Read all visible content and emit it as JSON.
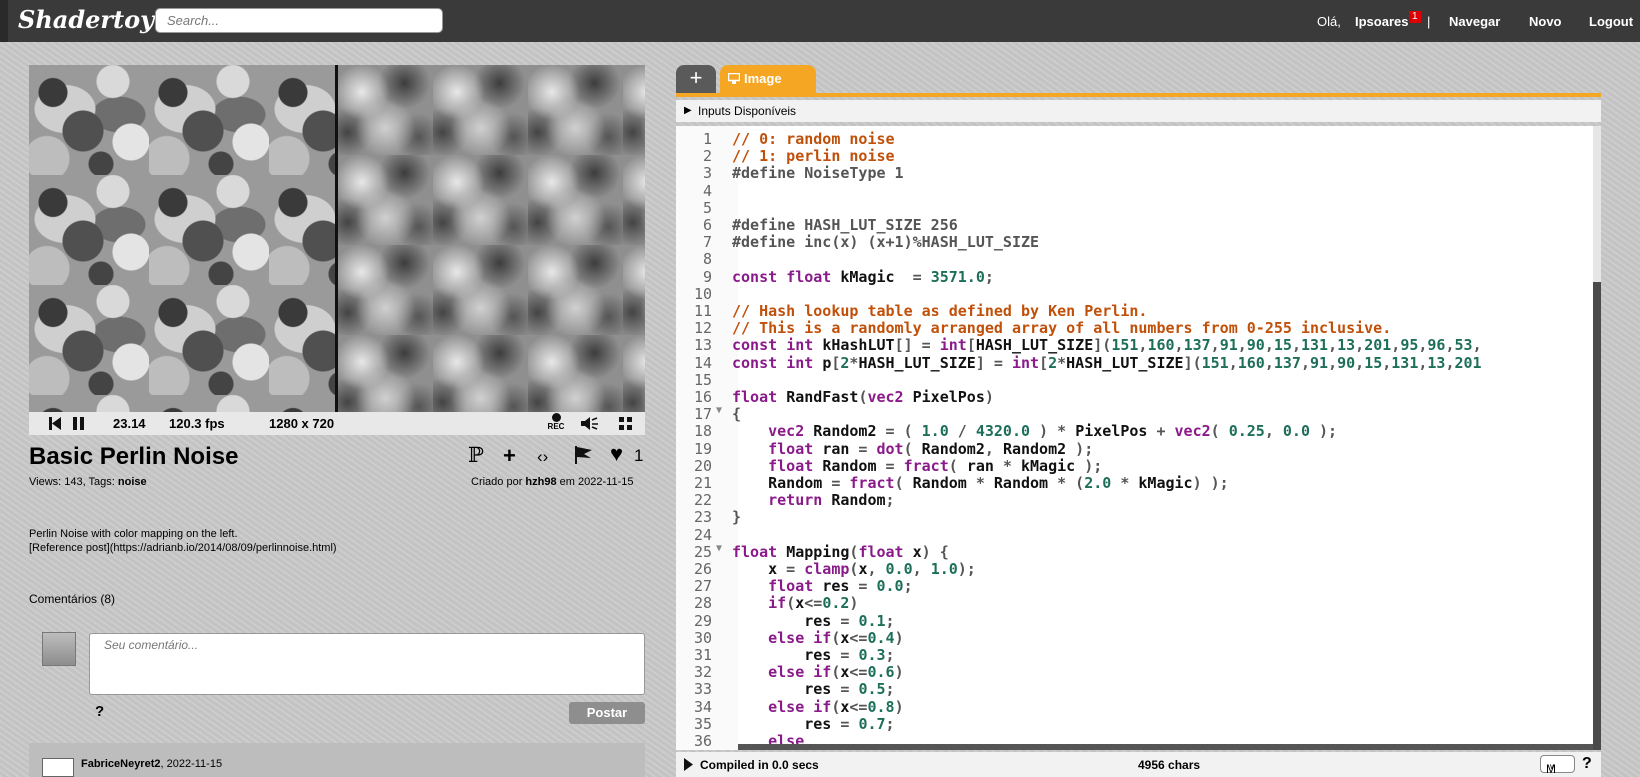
{
  "header": {
    "logo": "Shadertoy",
    "search_placeholder": "Search...",
    "greeting": "Olá,",
    "username": "Ipsoares",
    "notification_count": "1",
    "separator": "|",
    "nav_browse": "Navegar",
    "nav_new": "Novo",
    "nav_logout": "Logout"
  },
  "player": {
    "time": "23.14",
    "fps": "120.3 fps",
    "resolution": "1280 x 720",
    "rec_label": "REC"
  },
  "shader": {
    "title": "Basic Perlin Noise",
    "likes": "1",
    "meta_left_prefix": "Views: 143, Tags: ",
    "tag": "noise",
    "created_prefix": "Criado por ",
    "author": "hzh98",
    "created_suffix": " em 2022-11-15",
    "description_line1": "Perlin Noise with color mapping on the left.",
    "description_line2": "[Reference post](https://adrianb.io/2014/08/09/perlinnoise.html)"
  },
  "comments": {
    "heading": "Comentários (8)",
    "placeholder": "Seu comentário...",
    "help": "?",
    "post_label": "Postar",
    "first_author": "FabriceNeyret2",
    "first_date": ", 2022-11-15"
  },
  "editor": {
    "add_tab": "+",
    "tab_label": "Image",
    "inputs_label": "Inputs Disponíveis",
    "status_compiled": "Compiled in 0.0 secs",
    "char_count": "4956 chars",
    "mode": "M",
    "help": "?",
    "lines": [
      {
        "n": "1",
        "text": "// 0: random noise"
      },
      {
        "n": "2",
        "text": "// 1: perlin noise"
      },
      {
        "n": "3",
        "text": "#define NoiseType 1"
      },
      {
        "n": "4",
        "text": ""
      },
      {
        "n": "5",
        "text": ""
      },
      {
        "n": "6",
        "text": "#define HASH_LUT_SIZE 256"
      },
      {
        "n": "7",
        "text": "#define inc(x) (x+1)%HASH_LUT_SIZE"
      },
      {
        "n": "8",
        "text": ""
      },
      {
        "n": "9",
        "text": "const float kMagic  = 3571.0;"
      },
      {
        "n": "10",
        "text": ""
      },
      {
        "n": "11",
        "text": "// Hash lookup table as defined by Ken Perlin."
      },
      {
        "n": "12",
        "text": "// This is a randomly arranged array of all numbers from 0-255 inclusive."
      },
      {
        "n": "13",
        "text": "const int kHashLUT[] = int[HASH_LUT_SIZE](151,160,137,91,90,15,131,13,201,95,96,53,"
      },
      {
        "n": "14",
        "text": "const int p[2*HASH_LUT_SIZE] = int[2*HASH_LUT_SIZE](151,160,137,91,90,15,131,13,201"
      },
      {
        "n": "15",
        "text": ""
      },
      {
        "n": "16",
        "text": "float RandFast(vec2 PixelPos)"
      },
      {
        "n": "17",
        "text": "{"
      },
      {
        "n": "18",
        "text": "    vec2 Random2 = ( 1.0 / 4320.0 ) * PixelPos + vec2( 0.25, 0.0 );"
      },
      {
        "n": "19",
        "text": "    float ran = dot( Random2, Random2 );"
      },
      {
        "n": "20",
        "text": "    float Random = fract( ran * kMagic );"
      },
      {
        "n": "21",
        "text": "    Random = fract( Random * Random * (2.0 * kMagic) );"
      },
      {
        "n": "22",
        "text": "    return Random;"
      },
      {
        "n": "23",
        "text": "}"
      },
      {
        "n": "24",
        "text": ""
      },
      {
        "n": "25",
        "text": "float Mapping(float x) {"
      },
      {
        "n": "26",
        "text": "    x = clamp(x, 0.0, 1.0);"
      },
      {
        "n": "27",
        "text": "    float res = 0.0;"
      },
      {
        "n": "28",
        "text": "    if(x<=0.2)"
      },
      {
        "n": "29",
        "text": "        res = 0.1;"
      },
      {
        "n": "30",
        "text": "    else if(x<=0.4)"
      },
      {
        "n": "31",
        "text": "        res = 0.3;"
      },
      {
        "n": "32",
        "text": "    else if(x<=0.6)"
      },
      {
        "n": "33",
        "text": "        res = 0.5;"
      },
      {
        "n": "34",
        "text": "    else if(x<=0.8)"
      },
      {
        "n": "35",
        "text": "        res = 0.7;"
      },
      {
        "n": "36",
        "text": "    else"
      }
    ]
  }
}
